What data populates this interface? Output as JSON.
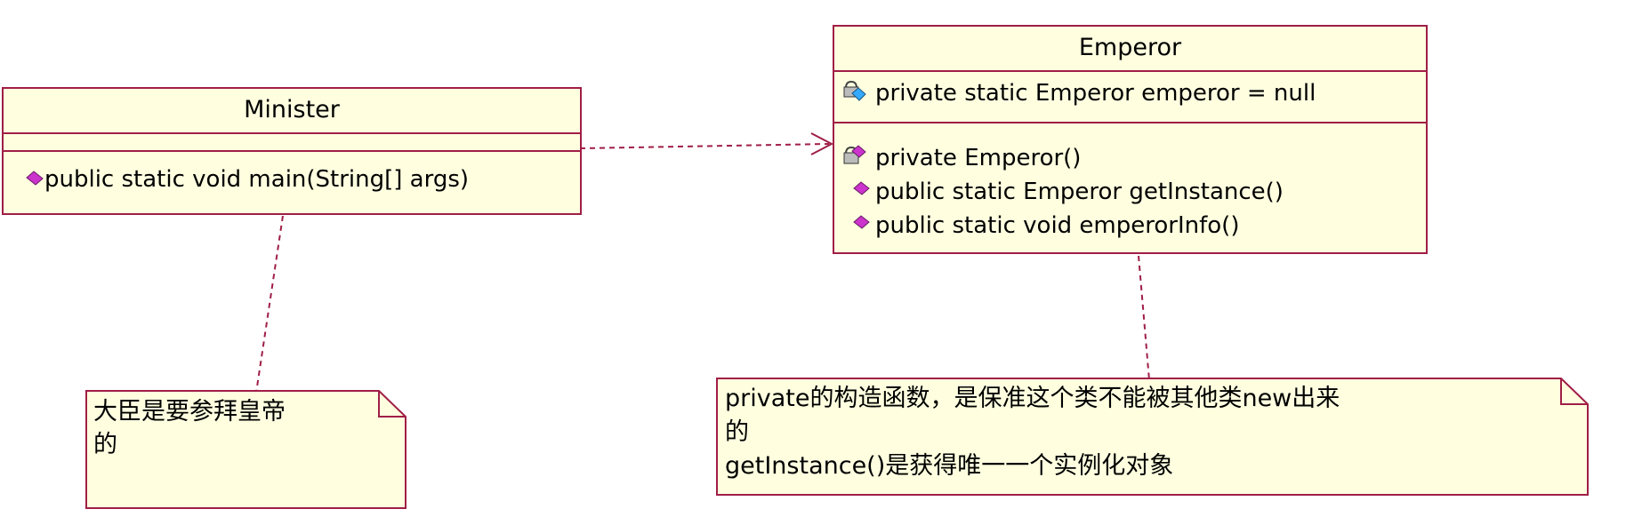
{
  "minister": {
    "name": "Minister",
    "operations": [
      {
        "visibility": "public",
        "label": "public static void main(String[] args)"
      }
    ]
  },
  "emperor": {
    "name": "Emperor",
    "attributes": [
      {
        "visibility": "private",
        "label": "private static Emperor emperor = null"
      }
    ],
    "operations": [
      {
        "visibility": "private",
        "label": "private Emperor()"
      },
      {
        "visibility": "public",
        "label": "public static Emperor getInstance()"
      },
      {
        "visibility": "public",
        "label": "public static void emperorInfo()"
      }
    ]
  },
  "notes": {
    "minister_note": [
      "大臣是要参拜皇帝",
      "的"
    ],
    "emperor_note": [
      "private的构造函数，是保准这个类不能被其他类new出来",
      "的",
      "getInstance()是获得唯一一个实例化对象"
    ]
  },
  "colors": {
    "border": "#a01e46",
    "fill": "#ffffe0",
    "public_icon": "#cc33cc",
    "static_icon": "#33aaff"
  },
  "icons": {
    "public_operation": "magenta-diamond-icon",
    "private_operation": "padlock-magenta-diamond-icon",
    "private_static_attribute": "padlock-blue-diamond-icon"
  }
}
